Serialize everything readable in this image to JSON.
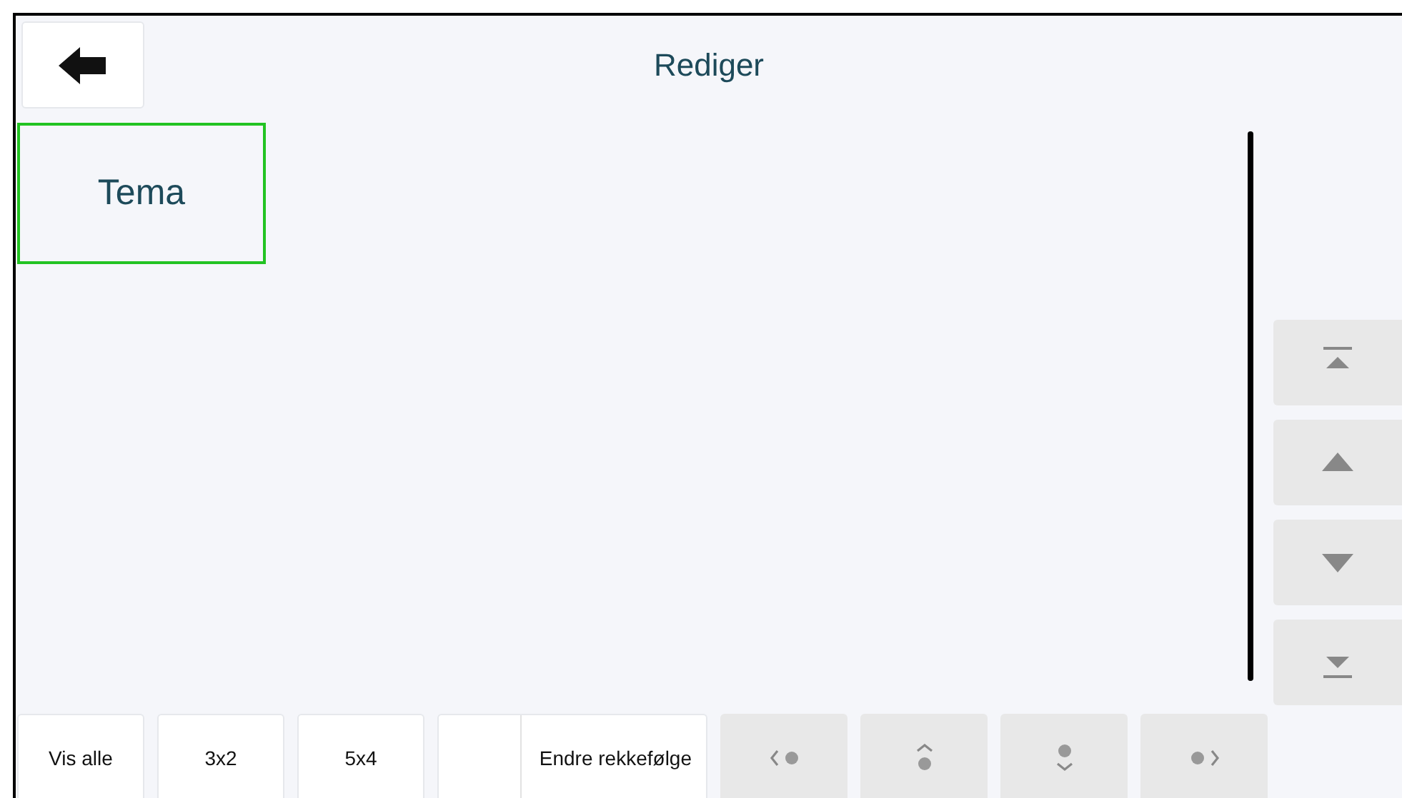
{
  "header": {
    "title": "Rediger"
  },
  "tiles": [
    {
      "label": "Tema",
      "selected": true
    }
  ],
  "side_buttons": [
    {
      "kind": "top"
    },
    {
      "kind": "up"
    },
    {
      "kind": "down"
    },
    {
      "kind": "bottom"
    }
  ],
  "bottom_buttons": [
    {
      "kind": "text",
      "label": "Vis alle",
      "disabled": false
    },
    {
      "kind": "text",
      "label": "3x2",
      "disabled": false
    },
    {
      "kind": "text",
      "label": "5x4",
      "disabled": false
    },
    {
      "kind": "wide",
      "label": "Endre rekkefølge",
      "disabled": false
    },
    {
      "kind": "left",
      "disabled": true
    },
    {
      "kind": "up",
      "disabled": true
    },
    {
      "kind": "down",
      "disabled": true
    },
    {
      "kind": "right",
      "disabled": true
    }
  ]
}
